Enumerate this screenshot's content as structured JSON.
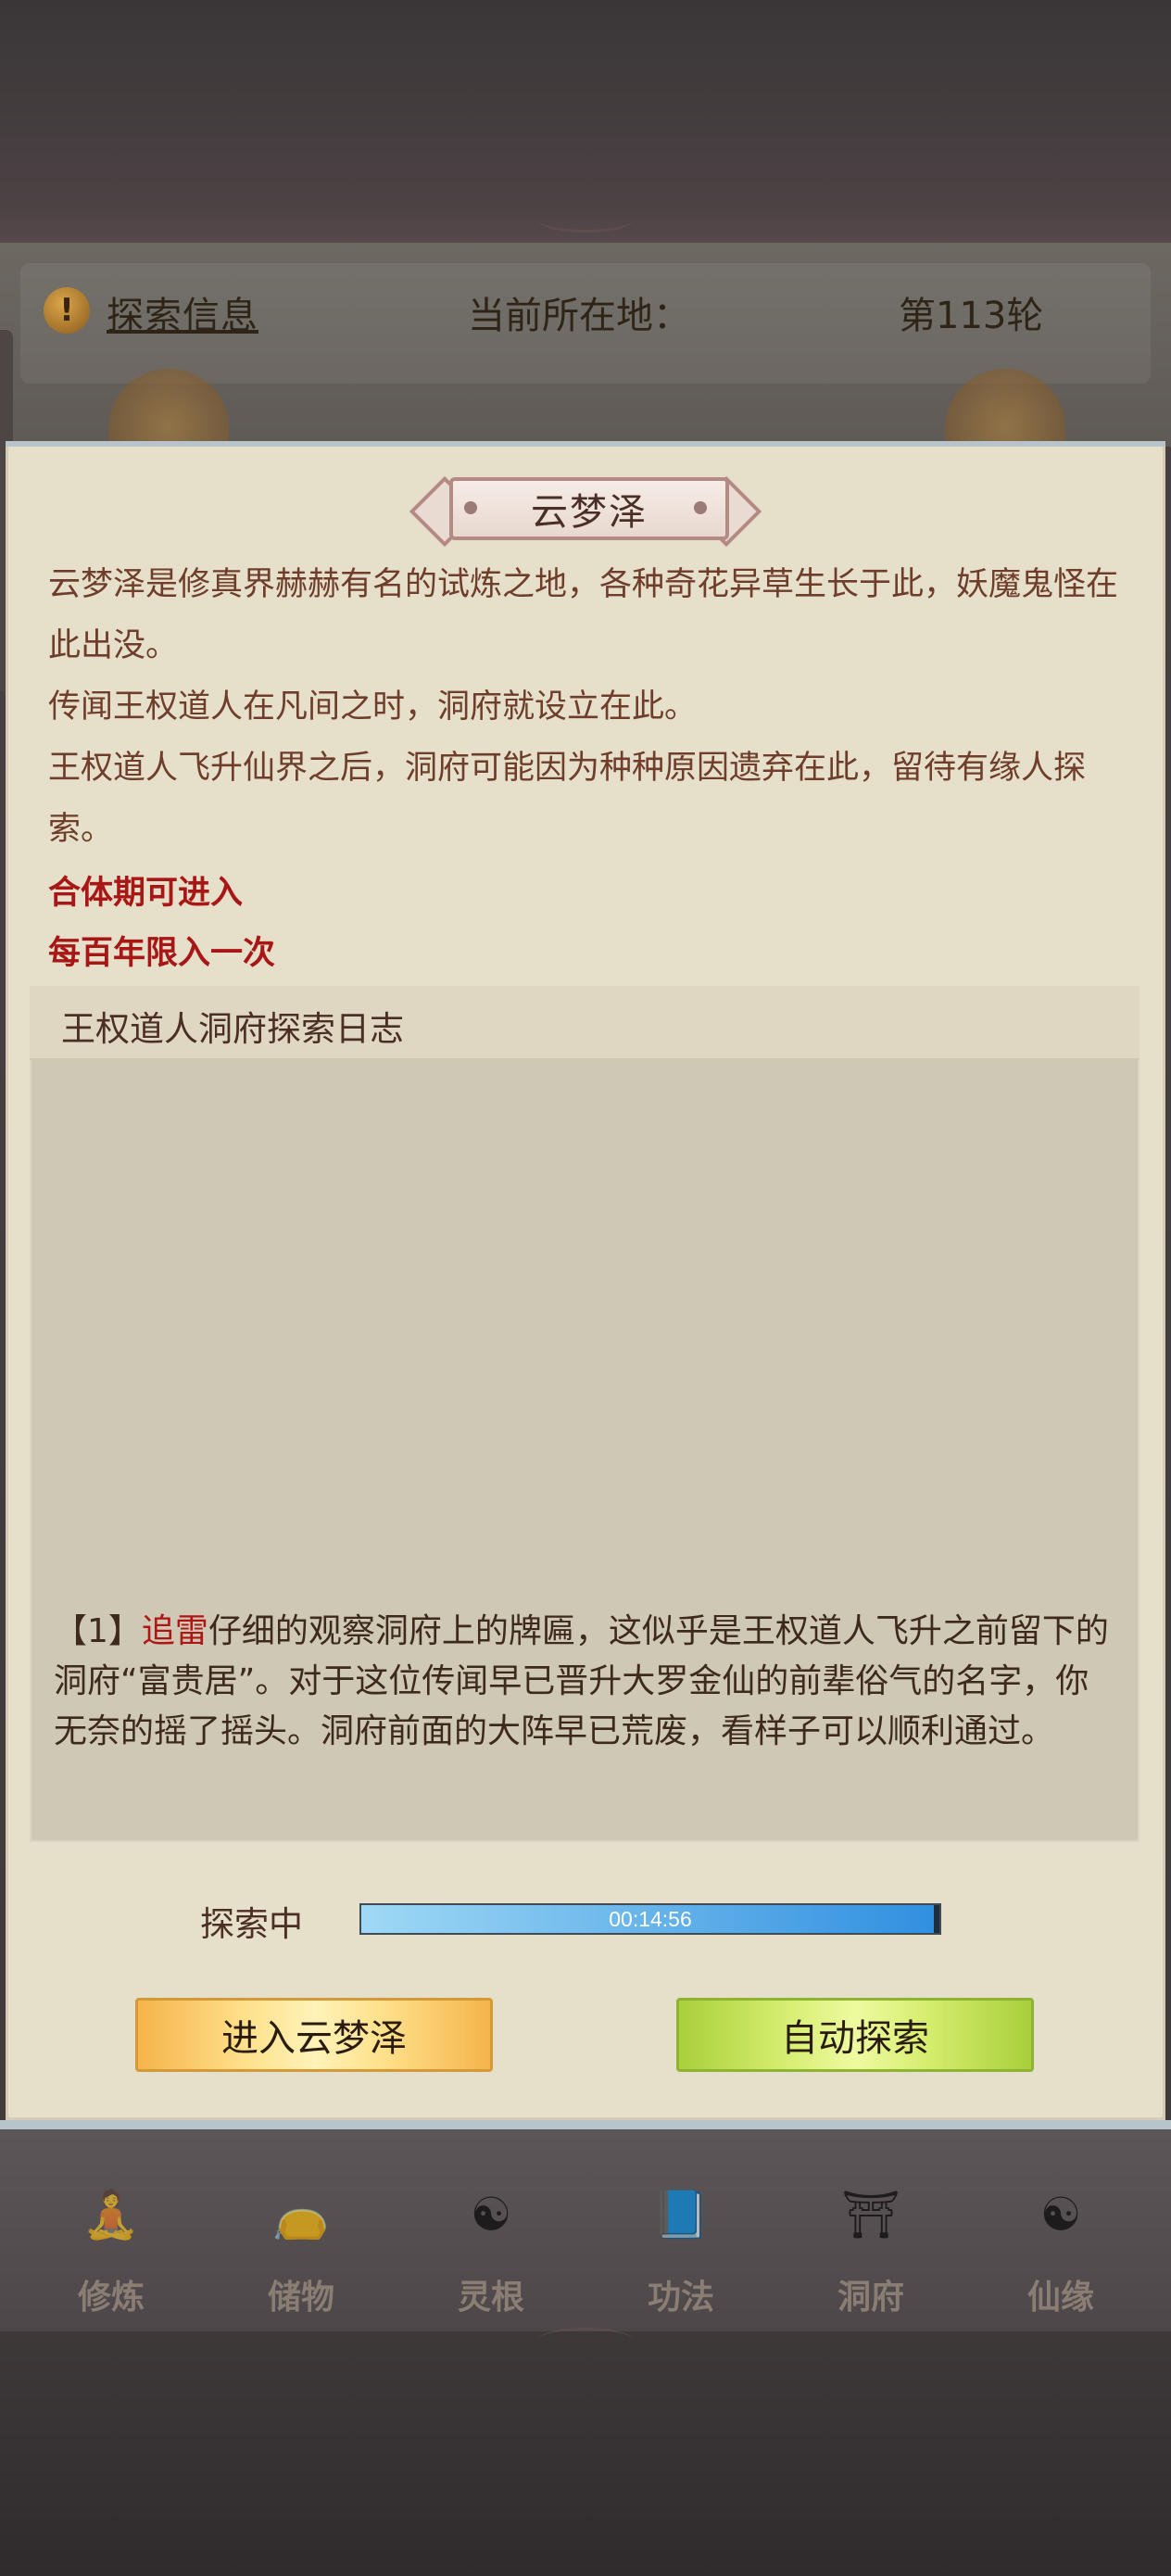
{
  "info_bar": {
    "icon": "exclamation-icon",
    "icon_glyph": "!",
    "link": "探索信息",
    "location_label": "当前所在地：",
    "round": "第113轮"
  },
  "panel": {
    "title": "云梦泽",
    "description": [
      "云梦泽是修真界赫赫有名的试炼之地，各种奇花异草生长于此，妖魔鬼怪在此出没。",
      "传闻王权道人在凡间之时，洞府就设立在此。",
      "王权道人飞升仙界之后，洞府可能因为种种原因遗弃在此，留待有缘人探索。"
    ],
    "requirements": [
      "合体期可进入",
      "每百年限入一次"
    ]
  },
  "log": {
    "title": "王权道人洞府探索日志",
    "entry": {
      "index": "【1】",
      "name": "追雷",
      "text": "仔细的观察洞府上的牌匾，这似乎是王权道人飞升之前留下的洞府“富贵居”。对于这位传闻早已晋升大罗金仙的前辈俗气的名字，你无奈的摇了摇头。洞府前面的大阵早已荒废，看样子可以顺利通过。"
    }
  },
  "progress": {
    "label": "探索中",
    "time": "00:14:56",
    "fraction": 1.0
  },
  "buttons": {
    "enter": "进入云梦泽",
    "auto": "自动探索"
  },
  "nav": [
    {
      "label": "修炼",
      "icon": "cultivate-icon",
      "glyph": "🧘"
    },
    {
      "label": "储物",
      "icon": "storage-bag-icon",
      "glyph": "👝"
    },
    {
      "label": "灵根",
      "icon": "spirit-root-icon",
      "glyph": "☯"
    },
    {
      "label": "功法",
      "icon": "skill-book-icon",
      "glyph": "📘"
    },
    {
      "label": "洞府",
      "icon": "cave-dwelling-icon",
      "glyph": "⛩"
    },
    {
      "label": "仙缘",
      "icon": "immortal-fate-icon",
      "glyph": "☯"
    }
  ],
  "colors": {
    "highlight_red": "#a81616",
    "progress_blue": "#2f8fe0",
    "button_gold": "#ffe08a",
    "button_green": "#d6ee70"
  }
}
